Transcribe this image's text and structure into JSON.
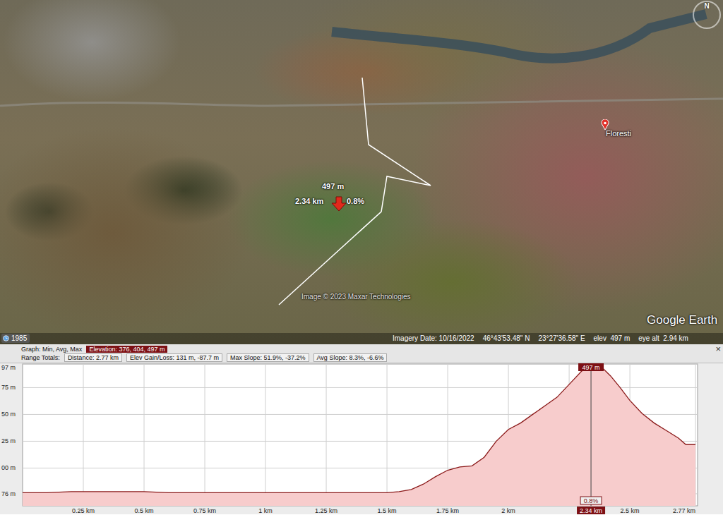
{
  "map": {
    "watermark": "Image © 2023 Maxar Technologies",
    "logo": "Google Earth",
    "compass": "N",
    "place_label": "Floresti",
    "measure": {
      "elevation": "497 m",
      "distance": "2.34 km",
      "slope": "0.8%"
    },
    "status": {
      "year": "1985",
      "imagery_date": "Imagery Date: 10/16/2022",
      "lat": "46°43'53.48\" N",
      "lon": "23°27'36.58\" E",
      "elev": "elev  497 m",
      "eye_alt": "eye alt  2.94 km"
    }
  },
  "graph": {
    "title": "Graph: Min, Avg, Max",
    "elevation": "Elevation: 376, 404, 497 m",
    "range_label": "Range Totals:",
    "totals": [
      "Distance: 2.77 km",
      "Elev Gain/Loss: 131 m, -87.7 m",
      "Max Slope: 51.9%, -37.2%",
      "Avg Slope: 8.3%, -6.6%"
    ],
    "close": "×",
    "y_ticks": [
      {
        "label": "97 m",
        "value": 497
      },
      {
        "label": "75 m",
        "value": 475
      },
      {
        "label": "50 m",
        "value": 450
      },
      {
        "label": "25 m",
        "value": 425
      },
      {
        "label": "00 m",
        "value": 400
      },
      {
        "label": "76 m",
        "value": 376
      }
    ],
    "x_ticks": [
      {
        "label": "0.25 km",
        "value": 0.25
      },
      {
        "label": "0.5 km",
        "value": 0.5
      },
      {
        "label": "0.75 km",
        "value": 0.75
      },
      {
        "label": "1 km",
        "value": 1
      },
      {
        "label": "1.25 km",
        "value": 1.25
      },
      {
        "label": "1.5 km",
        "value": 1.5
      },
      {
        "label": "1.75 km",
        "value": 1.75
      },
      {
        "label": "2 km",
        "value": 2
      },
      {
        "label": "2.5 km",
        "value": 2.5
      },
      {
        "label": "2.77 km",
        "value": 2.77
      }
    ],
    "series": {
      "distance_km": [
        0,
        0.1,
        0.2,
        0.3,
        0.4,
        0.5,
        0.6,
        0.7,
        0.8,
        0.9,
        1.0,
        1.1,
        1.2,
        1.3,
        1.4,
        1.5,
        1.55,
        1.6,
        1.65,
        1.7,
        1.75,
        1.8,
        1.85,
        1.9,
        1.95,
        2.0,
        2.05,
        2.1,
        2.15,
        2.2,
        2.25,
        2.3,
        2.34,
        2.38,
        2.42,
        2.46,
        2.5,
        2.55,
        2.6,
        2.65,
        2.7,
        2.73,
        2.77
      ],
      "elevation_m": [
        377,
        377,
        378,
        378,
        378,
        378,
        377,
        377,
        377,
        377,
        377,
        377,
        377,
        377,
        377,
        377,
        378,
        380,
        385,
        392,
        398,
        401,
        402,
        410,
        425,
        436,
        442,
        450,
        458,
        466,
        478,
        490,
        497,
        495,
        486,
        475,
        463,
        451,
        442,
        435,
        428,
        422,
        422
      ]
    },
    "cursor": {
      "distance": 2.34,
      "elevation_label": "497 m",
      "slope_label": "0.8%",
      "distance_label": "2.34 km"
    }
  }
}
